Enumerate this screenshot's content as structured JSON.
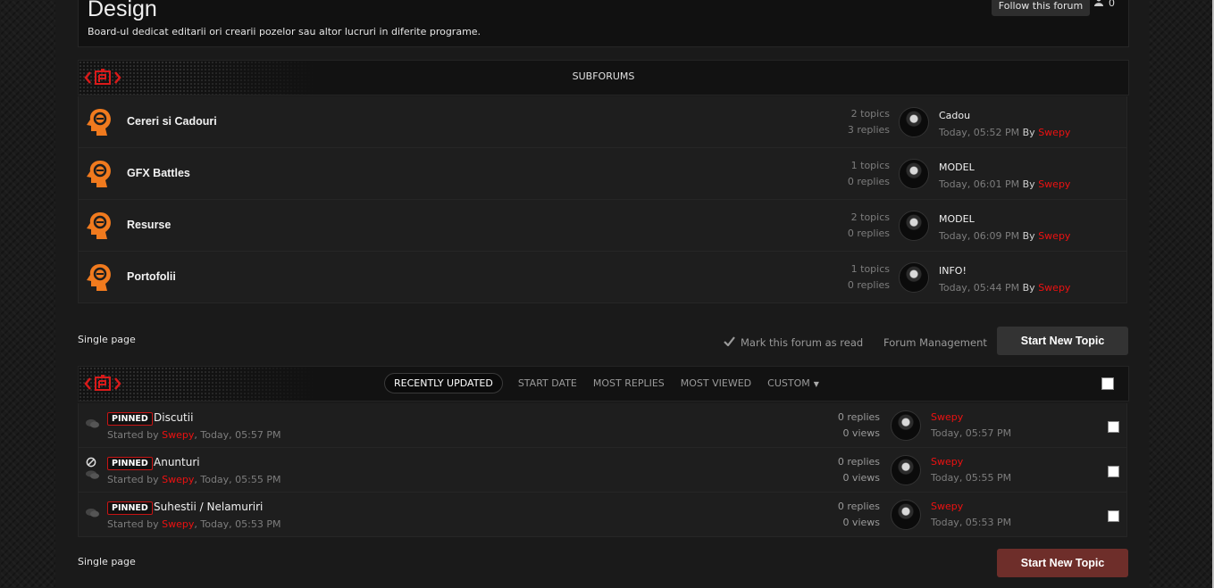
{
  "forum": {
    "title": "Design",
    "description": "Board-ul dedicat editarii ori crearii pozelor sau altor lucruri in diferite programe.",
    "follow_label": "Follow this forum",
    "followers_count": "0"
  },
  "subforums": {
    "header": "SUBFORUMS",
    "items": [
      {
        "name": "Cereri si Cadouri",
        "topics": "2 topics",
        "replies": "3 replies",
        "last_title": "Cadou",
        "last_date": "Today, 05:52 PM",
        "by_label": "By",
        "last_author": "Swepy"
      },
      {
        "name": "GFX Battles",
        "topics": "1 topics",
        "replies": "0 replies",
        "last_title": "MODEL",
        "last_date": "Today, 06:01 PM",
        "by_label": "By",
        "last_author": "Swepy"
      },
      {
        "name": "Resurse",
        "topics": "2 topics",
        "replies": "0 replies",
        "last_title": "MODEL",
        "last_date": "Today, 06:09 PM",
        "by_label": "By",
        "last_author": "Swepy"
      },
      {
        "name": "Portofolii",
        "topics": "1 topics",
        "replies": "0 replies",
        "last_title": "INFO!",
        "last_date": "Today, 05:44 PM",
        "by_label": "By",
        "last_author": "Swepy"
      }
    ]
  },
  "actions": {
    "pagination_top": "Single page",
    "mark_read": "Mark this forum as read",
    "management": "Forum Management",
    "start_topic": "Start New Topic",
    "pagination_bottom": "Single page",
    "start_topic_bottom": "Start New Topic"
  },
  "sort_tabs": {
    "recently_updated": "RECENTLY UPDATED",
    "start_date": "START DATE",
    "most_replies": "MOST REPLIES",
    "most_viewed": "MOST VIEWED",
    "custom": "CUSTOM"
  },
  "topics": [
    {
      "badge": "PINNED",
      "title": "Discutii",
      "started_prefix": "Started by",
      "author": "Swepy",
      "date": ", Today, 05:57 PM",
      "replies": "0 replies",
      "views": "0 views",
      "last_author": "Swepy",
      "last_date": "Today, 05:57 PM"
    },
    {
      "badge": "PINNED",
      "title": "Anunturi",
      "started_prefix": "Started by",
      "author": "Swepy",
      "date": ", Today, 05:55 PM",
      "replies": "0 replies",
      "views": "0 views",
      "last_author": "Swepy",
      "last_date": "Today, 05:55 PM"
    },
    {
      "badge": "PINNED",
      "title": "Suhestii / Nelamuriri",
      "started_prefix": "Started by",
      "author": "Swepy",
      "date": ", Today, 05:53 PM",
      "replies": "0 replies",
      "views": "0 views",
      "last_author": "Swepy",
      "last_date": "Today, 05:53 PM"
    }
  ],
  "colors": {
    "accent_red": "#ee1111",
    "forum_icon_orange": "#f07a1e",
    "start_btn_bottom": "#6e2e2a",
    "start_btn_top": "#333333"
  }
}
